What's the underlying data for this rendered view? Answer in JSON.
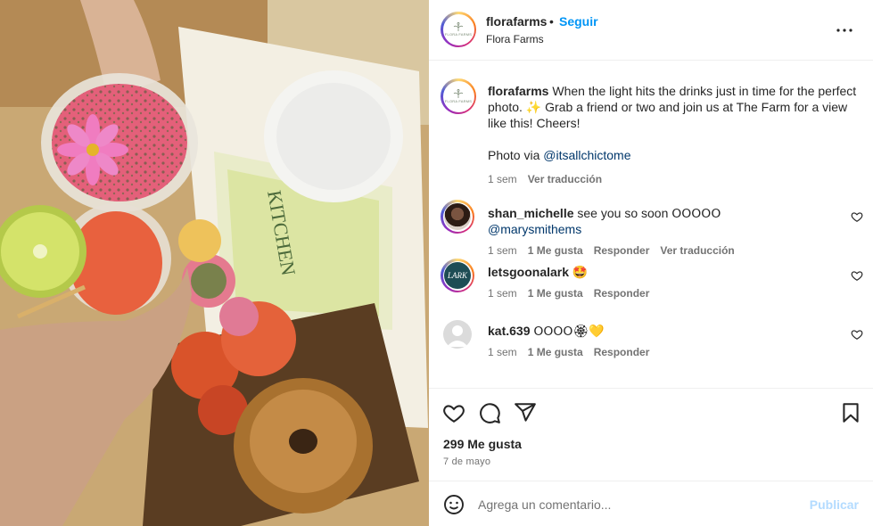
{
  "header": {
    "username": "florafarms",
    "dot": "•",
    "follow_label": "Seguir",
    "location": "Flora Farms",
    "avatar_text": "FLORA FARMS"
  },
  "caption": {
    "username": "florafarms",
    "text_1": "When the light hits the drinks just in time for the perfect photo. ✨ Grab a friend or two and join us at The Farm for a view like this! Cheers!",
    "text_2": "Photo via ",
    "mention": "@itsallchictome",
    "time": "1 sem",
    "translate": "Ver traducción"
  },
  "comments": [
    {
      "username": "shan_michelle",
      "text": "see you so soon 𝖮𝖮𝖮𝖮𝖮",
      "mention": "@marysmithems",
      "time": "1 sem",
      "likes": "1 Me gusta",
      "reply": "Responder",
      "translate": "Ver traducción"
    },
    {
      "username": "letsgoonalark",
      "text": "🤩",
      "avatar_text": "LARK",
      "time": "1 sem",
      "likes": "1 Me gusta",
      "reply": "Responder"
    },
    {
      "username": "kat.639",
      "text": "𝖮𝖮𝖮𝖮🏵💛",
      "time": "1 sem",
      "likes": "1 Me gusta",
      "reply": "Responder"
    }
  ],
  "actions": {
    "likes": "299 Me gusta",
    "date": "7 de mayo"
  },
  "add_comment": {
    "placeholder": "Agrega un comentario...",
    "publish_label": "Publicar"
  },
  "icons": [
    "heart-icon",
    "comment-icon",
    "share-icon",
    "bookmark-icon",
    "more-icon",
    "emoji-icon",
    "small-heart-icon"
  ],
  "colors": {
    "accent": "#0095f6",
    "link": "#00376b",
    "muted": "#737373",
    "publish_disabled": "#b3dbff"
  }
}
